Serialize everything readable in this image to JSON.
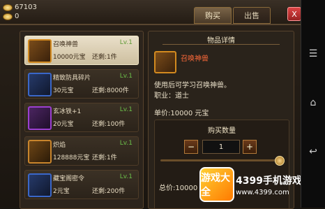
{
  "header": {
    "gold_amount": "67103",
    "silver_amount": "0",
    "tabs": [
      {
        "label": "购买"
      },
      {
        "label": "出售"
      }
    ],
    "close_label": "X"
  },
  "left_list": {
    "items": [
      {
        "name": "召唤神兽",
        "level": "Lv.1",
        "price": "10000元宝",
        "remain": "还剩:1件",
        "selected": true
      },
      {
        "name": "精致防具碎片",
        "level": "Lv.1",
        "price": "30元宝",
        "remain": "还剩:8000件",
        "selected": false
      },
      {
        "name": "玄冰铁+1",
        "level": "Lv.1",
        "price": "20元宝",
        "remain": "还剩:100件",
        "selected": false
      },
      {
        "name": "炽焰",
        "level": "Lv.1",
        "price": "128888元宝",
        "remain": "还剩:1件",
        "selected": false
      },
      {
        "name": "藏宝阁密令",
        "level": "Lv.1",
        "price": "2元宝",
        "remain": "还剩:200件",
        "selected": false
      }
    ]
  },
  "detail": {
    "title": "物品详情",
    "item_name": "召唤神兽",
    "description": "使用后可学习召唤神兽。",
    "job": "职业：道士",
    "unit_price": "单价:10000 元宝"
  },
  "quantity": {
    "title": "购买数量",
    "minus": "−",
    "plus": "+",
    "value": "1",
    "total": "总价:10000 元宝"
  },
  "watermark": {
    "badge": "游戏大全",
    "text": "4399手机游戏网",
    "url": "www.4399.com"
  },
  "android_nav": {
    "icons": [
      "menu-icon",
      "home-icon",
      "back-icon"
    ]
  }
}
